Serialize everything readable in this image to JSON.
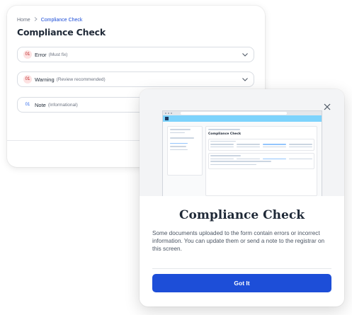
{
  "breadcrumb": {
    "home": "Home",
    "current": "Compliance Check"
  },
  "page": {
    "title": "Compliance Check"
  },
  "accordions": [
    {
      "count": "01",
      "label": "Error",
      "sub": "(Must fix)",
      "kind": "error"
    },
    {
      "count": "01",
      "label": "Warning",
      "sub": "(Review recommended)",
      "kind": "warning"
    },
    {
      "count": "01",
      "label": "Note",
      "sub": "(Informational)",
      "kind": "note"
    }
  ],
  "modal": {
    "title": "Compliance Check",
    "body": "Some documents uploaded to the form contain errors or incorrect information. You can update them or send a note to the registrar on this screen.",
    "button": "Got It"
  },
  "colors": {
    "primary": "#1d4ed8",
    "error_bg": "#fde2e2",
    "error_text": "#b91c1c",
    "note_text": "#2563eb"
  },
  "icons": {
    "close": "close-icon",
    "chevron": "chevron-down-icon",
    "breadcrumb_sep": "chevron-right-icon"
  }
}
